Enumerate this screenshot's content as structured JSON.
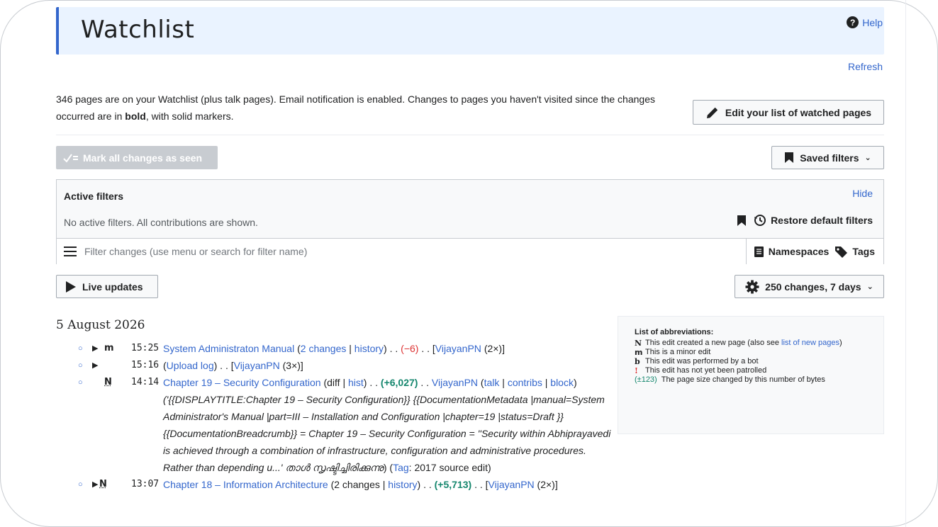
{
  "header": {
    "title": "Watchlist",
    "help_label": "Help",
    "refresh_label": "Refresh"
  },
  "intro": {
    "text_before_bold": "346 pages are on your Watchlist (plus talk pages). Email notification is enabled. Changes to pages you haven't visited since the changes occurred are in ",
    "bold_word": "bold",
    "text_after_bold": ", with solid markers."
  },
  "toolbar": {
    "edit_watched_label": "Edit your list of watched pages",
    "mark_seen_label": "Mark all changes as seen",
    "saved_filters_label": "Saved filters"
  },
  "filters": {
    "active_title": "Active filters",
    "hide_label": "Hide",
    "no_active_text": "No active filters. All contributions are shown.",
    "restore_label": "Restore default filters",
    "search_placeholder": "Filter changes (use menu or search for filter name)",
    "namespaces_label": "Namespaces",
    "tags_label": "Tags"
  },
  "controls": {
    "live_updates_label": "Live updates",
    "changes_period_label": "250 changes, 7 days"
  },
  "date_heading": "5 August 2026",
  "changes": [
    {
      "flags": "m",
      "time": "15:25",
      "page": "System Administraton Manual",
      "changes_link": "2 changes",
      "history_link": "history",
      "diff": "(−6)",
      "user": "VijayanPN",
      "count": "(2×)"
    },
    {
      "flags": "",
      "time": "15:16",
      "log_link": "Upload log",
      "user": "VijayanPN",
      "count": "(3×)"
    },
    {
      "flags": "N",
      "time": "14:14",
      "page": "Chapter 19 – Security Configuration",
      "diff_text": "diff",
      "hist_link": "hist",
      "diff": "(+6,027)",
      "user": "VijayanPN",
      "talk": "talk",
      "contribs": "contribs",
      "block": "block",
      "comment": "('{{DISPLAYTITLE:Chapter 19 – Security Configuration}} {{DocumentationMetadata |manual=System Administrator's Manual |part=III – Installation and Configuration |chapter=19 |status=Draft }} {{DocumentationBreadcrumb}} = Chapter 19 – Security Configuration = ''Security within Abhiprayavedi is achieved through a combination of infrastructure, configuration and administrative procedures. Rather than depending u...'",
      "ml_text": "താൾ സൃഷ്ടിച്ചിരിക്കുന്നു",
      "tag_link": "Tag",
      "tag_value": "2017 source edit"
    },
    {
      "flags": "N",
      "time": "13:07",
      "page": "Chapter 18 – Information Architecture",
      "changes_text": "2 changes",
      "history_link": "history",
      "diff": "(+5,713)",
      "user": "VijayanPN",
      "count": "(2×)"
    }
  ],
  "abbreviations": {
    "title": "List of abbreviations:",
    "items": [
      {
        "key": "N",
        "text": "This edit created a new page (also see ",
        "link": "list of new pages",
        "after": ")"
      },
      {
        "key": "m",
        "text": "This is a minor edit"
      },
      {
        "key": "b",
        "text": "This edit was performed by a bot"
      },
      {
        "key": "!",
        "text": "This edit has not yet been patrolled"
      },
      {
        "key": "(±123)",
        "text": "The page size changed by this number of bytes"
      }
    ]
  }
}
